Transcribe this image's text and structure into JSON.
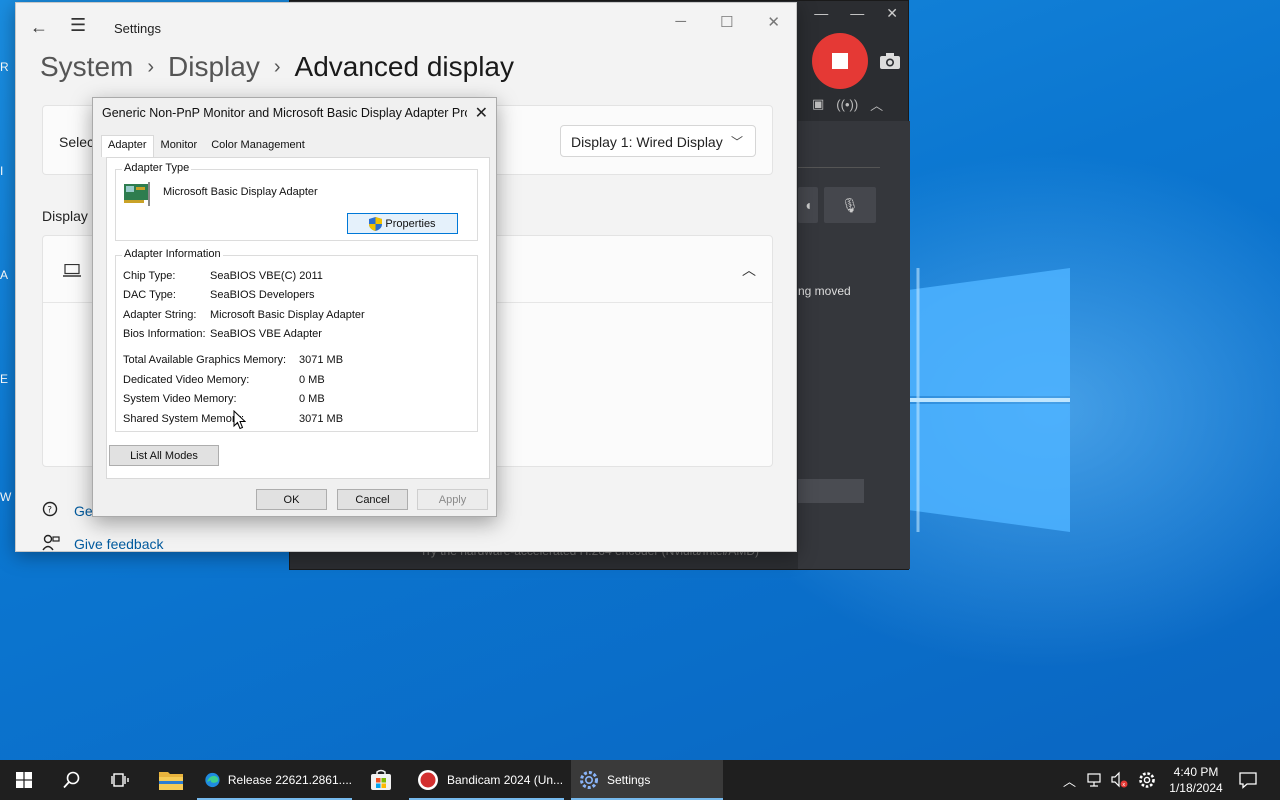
{
  "colors": {
    "accent": "#0078d7",
    "desktop": "#0b76d0",
    "taskbar": "#1f1f1f",
    "record": "#e53935"
  },
  "bandicam": {
    "status_text": "ng moved",
    "hint_text": "Try the hardware-accelerated H.264 encoder (Nvidia/Intel/AMD)"
  },
  "settings": {
    "app_title": "Settings",
    "breadcrumb": {
      "level1": "System",
      "level2": "Display",
      "current": "Advanced display"
    },
    "select_label": "Select",
    "display_dropdown": "Display 1: Wired Display",
    "section_heading": "Display i",
    "help_links": {
      "get_help": "Get",
      "give_feedback": "Give feedback"
    }
  },
  "dialog": {
    "title": "Generic Non-PnP Monitor and Microsoft Basic Display Adapter Pro...",
    "tabs": [
      "Adapter",
      "Monitor",
      "Color Management"
    ],
    "adapter_type_title": "Adapter Type",
    "adapter_name": "Microsoft Basic Display Adapter",
    "properties_label": "Properties",
    "adapter_info_title": "Adapter Information",
    "info": [
      {
        "label": "Chip Type:",
        "value": "SeaBIOS VBE(C) 2011"
      },
      {
        "label": "DAC Type:",
        "value": "SeaBIOS Developers"
      },
      {
        "label": "Adapter String:",
        "value": "Microsoft Basic Display Adapter"
      },
      {
        "label": "Bios Information:",
        "value": "SeaBIOS VBE Adapter"
      }
    ],
    "memory": [
      {
        "label": "Total Available Graphics Memory:",
        "value": "3071 MB"
      },
      {
        "label": "Dedicated Video Memory:",
        "value": "0 MB"
      },
      {
        "label": "System Video Memory:",
        "value": "0 MB"
      },
      {
        "label": "Shared System Memory:",
        "value": "3071 MB"
      }
    ],
    "list_modes_label": "List All Modes",
    "ok_label": "OK",
    "cancel_label": "Cancel",
    "apply_label": "Apply"
  },
  "desktop_edge": [
    "R",
    "I",
    "A",
    "E",
    "W"
  ],
  "taskbar": {
    "apps": [
      {
        "label": "Release 22621.2861...."
      },
      {
        "label": "Bandicam 2024 (Un..."
      },
      {
        "label": "Settings"
      }
    ],
    "time": "4:40 PM",
    "date": "1/18/2024"
  }
}
